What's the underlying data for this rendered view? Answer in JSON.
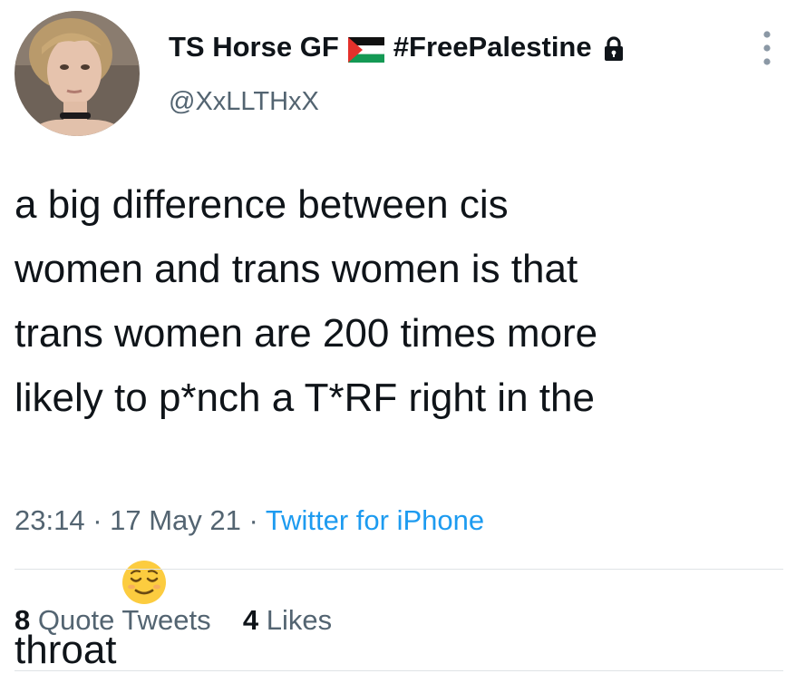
{
  "author": {
    "display_name": "TS Horse GF",
    "hashtag": "#FreePalestine",
    "handle": "@XxLLTHxX",
    "flag_icon": "palestine-flag-icon",
    "lock_icon": "lock-icon"
  },
  "tweet": {
    "text_line1": "a big difference between cis",
    "text_line2": "women and trans women is that",
    "text_line3": "trans women are 200 times more",
    "text_line4": "likely to p*nch a T*RF right in the",
    "text_line5": "throat",
    "emoji": "relieved-face-emoji"
  },
  "meta": {
    "time": "23:14",
    "sep1": " · ",
    "date": "17 May 21",
    "sep2": " · ",
    "source": "Twitter for iPhone"
  },
  "stats": {
    "quote_count": "8",
    "quote_label": "Quote Tweets",
    "like_count": "4",
    "like_label": "Likes"
  },
  "colors": {
    "text": "#0f1419",
    "secondary": "#536471",
    "link": "#1d9bf0",
    "divider": "#dfe3e6"
  }
}
